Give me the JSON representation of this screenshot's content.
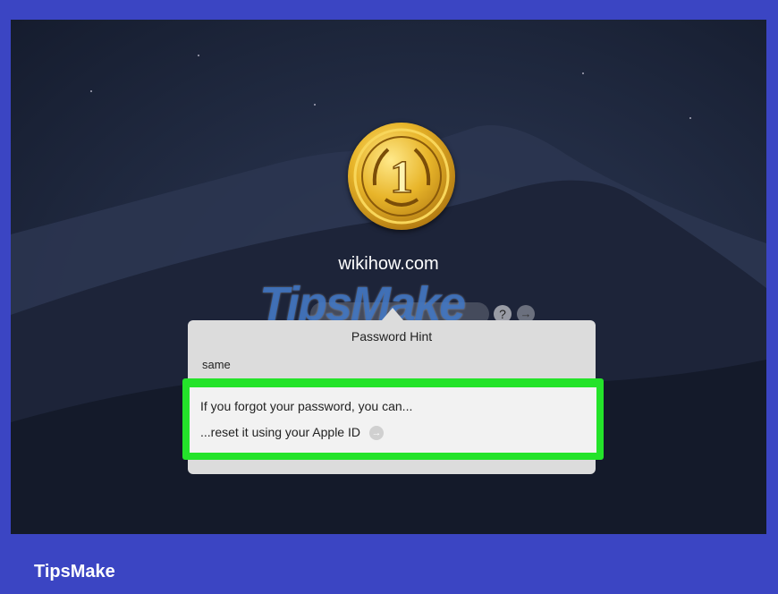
{
  "login": {
    "username": "wikihow.com",
    "help_glyph": "?",
    "submit_glyph": "→"
  },
  "avatar": {
    "digit": "1",
    "icon": "gold-medal-icon"
  },
  "password_hint": {
    "title": "Password Hint",
    "hint": "same"
  },
  "recovery": {
    "line1": "If you forgot your password, you can...",
    "line2": "...reset it using your Apple ID",
    "arrow_glyph": "→"
  },
  "watermark": "TipsMake",
  "footer": {
    "brand": "TipsMake"
  },
  "colors": {
    "frame": "#3b45c3",
    "highlight": "#24e32a",
    "popover": "#dcdcdc"
  }
}
